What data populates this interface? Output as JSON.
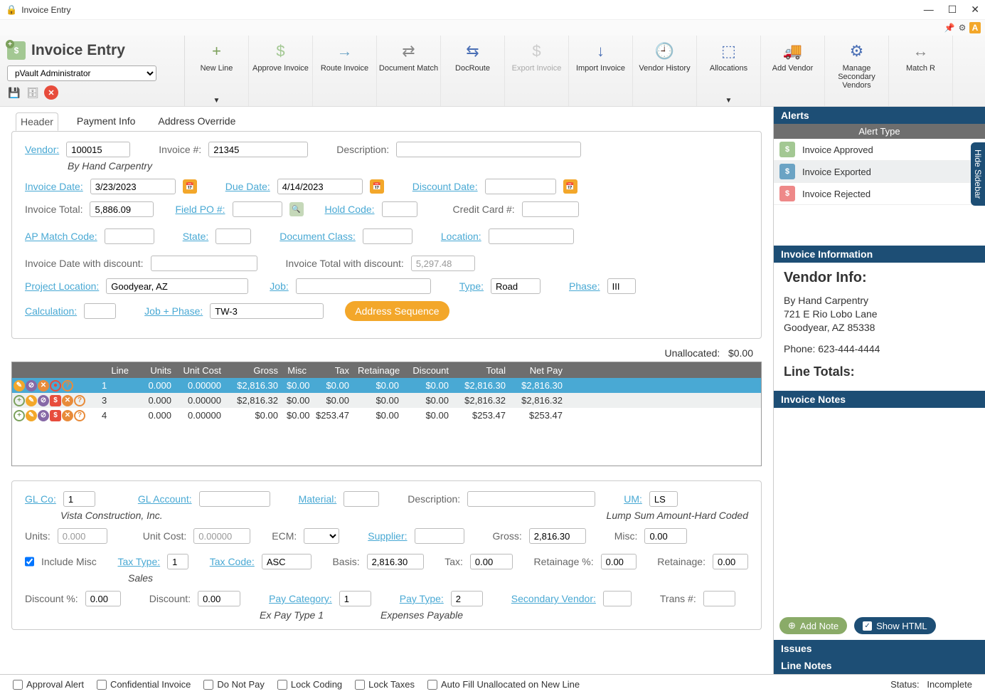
{
  "window": {
    "title": "Invoice Entry"
  },
  "app": {
    "title": "Invoice Entry",
    "user_select": "pVault Administrator"
  },
  "ribbon": [
    {
      "label": "New Line",
      "color": "#7ba05b",
      "glyph": "+",
      "arrow": true
    },
    {
      "label": "Approve Invoice",
      "color": "#a3c893",
      "glyph": "$"
    },
    {
      "label": "Route Invoice",
      "color": "#6ba3c4",
      "glyph": "→"
    },
    {
      "label": "Document Match",
      "color": "#888",
      "glyph": "⇄"
    },
    {
      "label": "DocRoute",
      "color": "#4a6fb5",
      "glyph": "⇆"
    },
    {
      "label": "Export Invoice",
      "color": "#ccc",
      "glyph": "$",
      "disabled": true
    },
    {
      "label": "Import Invoice",
      "color": "#4a6fb5",
      "glyph": "↓"
    },
    {
      "label": "Vendor History",
      "color": "#4a6fb5",
      "glyph": "🕘"
    },
    {
      "label": "Allocations",
      "color": "#4a6fb5",
      "glyph": "⬚",
      "arrow": true
    },
    {
      "label": "Add Vendor",
      "color": "#4a6fb5",
      "glyph": "🚚"
    },
    {
      "label": "Manage Secondary Vendors",
      "color": "#4a6fb5",
      "glyph": "⚙"
    },
    {
      "label": "Match R",
      "color": "#888",
      "glyph": "↔"
    }
  ],
  "tabs": [
    "Header",
    "Payment Info",
    "Address Override"
  ],
  "active_tab": "Header",
  "header": {
    "vendor_label": "Vendor:",
    "vendor": "100015",
    "vendor_name": "By Hand Carpentry",
    "invoice_num_label": "Invoice #:",
    "invoice_num": "21345",
    "description_label": "Description:",
    "description": "",
    "invoice_date_label": "Invoice Date:",
    "invoice_date": "3/23/2023",
    "due_date_label": "Due Date:",
    "due_date": "4/14/2023",
    "discount_date_label": "Discount Date:",
    "discount_date": "",
    "invoice_total_label": "Invoice Total:",
    "invoice_total": "5,886.09",
    "field_po_label": "Field PO #:",
    "field_po": "",
    "hold_code_label": "Hold Code:",
    "hold_code": "",
    "credit_card_label": "Credit Card #:",
    "credit_card": "",
    "ap_match_label": "AP Match Code:",
    "ap_match": "",
    "state_label": "State:",
    "state": "",
    "doc_class_label": "Document Class:",
    "doc_class": "",
    "location_label": "Location:",
    "location": "",
    "inv_date_disc_label": "Invoice Date with discount:",
    "inv_date_disc": "",
    "inv_total_disc_label": "Invoice Total with discount:",
    "inv_total_disc": "5,297.48",
    "proj_loc_label": "Project Location:",
    "proj_loc": "Goodyear, AZ",
    "job_label": "Job:",
    "job": "",
    "type_label": "Type:",
    "type": "Road",
    "phase_label": "Phase:",
    "phase": "III",
    "calc_label": "Calculation:",
    "calc": "",
    "job_phase_label": "Job + Phase:",
    "job_phase": "TW-3",
    "addr_seq_btn": "Address Sequence"
  },
  "unallocated": {
    "label": "Unallocated:",
    "value": "$0.00"
  },
  "grid": {
    "cols": [
      "Line",
      "Units",
      "Unit Cost",
      "Gross",
      "Misc",
      "Tax",
      "Retainage",
      "Discount",
      "Total",
      "Net Pay"
    ],
    "rows": [
      {
        "line": "1",
        "units": "0.000",
        "unitcost": "0.00000",
        "gross": "$2,816.30",
        "misc": "$0.00",
        "tax": "$0.00",
        "ret": "$0.00",
        "disc": "$0.00",
        "total": "$2,816.30",
        "net": "$2,816.30",
        "sel": true
      },
      {
        "line": "3",
        "units": "0.000",
        "unitcost": "0.00000",
        "gross": "$2,816.32",
        "misc": "$0.00",
        "tax": "$0.00",
        "ret": "$0.00",
        "disc": "$0.00",
        "total": "$2,816.32",
        "net": "$2,816.32"
      },
      {
        "line": "4",
        "units": "0.000",
        "unitcost": "0.00000",
        "gross": "$0.00",
        "misc": "$0.00",
        "tax": "$253.47",
        "ret": "$0.00",
        "disc": "$0.00",
        "total": "$253.47",
        "net": "$253.47"
      }
    ]
  },
  "detail": {
    "glco_label": "GL Co:",
    "glco": "1",
    "glco_name": "Vista Construction, Inc.",
    "glacct_label": "GL Account:",
    "glacct": "",
    "material_label": "Material:",
    "material": "",
    "desc_label": "Description:",
    "desc": "",
    "um_label": "UM:",
    "um": "LS",
    "um_name": "Lump Sum Amount-Hard Coded",
    "units_label": "Units:",
    "units": "0.000",
    "unitcost_label": "Unit Cost:",
    "unitcost": "0.00000",
    "ecm_label": "ECM:",
    "ecm": "",
    "supplier_label": "Supplier:",
    "supplier": "",
    "gross_label": "Gross:",
    "gross": "2,816.30",
    "misc_label": "Misc:",
    "misc": "0.00",
    "include_misc_label": "Include Misc",
    "taxtype_label": "Tax Type:",
    "taxtype": "1",
    "taxtype_name": "Sales",
    "taxcode_label": "Tax Code:",
    "taxcode": "ASC",
    "basis_label": "Basis:",
    "basis": "2,816.30",
    "tax_label": "Tax:",
    "tax": "0.00",
    "retpct_label": "Retainage %:",
    "retpct": "0.00",
    "ret_label": "Retainage:",
    "ret": "0.00",
    "discpct_label": "Discount %:",
    "discpct": "0.00",
    "disc_label": "Discount:",
    "disc": "0.00",
    "paycat_label": "Pay Category:",
    "paycat": "1",
    "paycat_name": "Ex Pay Type 1",
    "paytype_label": "Pay Type:",
    "paytype": "2",
    "paytype_name": "Expenses Payable",
    "secvendor_label": "Secondary Vendor:",
    "secvendor": "",
    "trans_label": "Trans #:",
    "trans": ""
  },
  "sidebar": {
    "alerts_title": "Alerts",
    "alert_type_label": "Alert Type",
    "alerts": [
      {
        "label": "Invoice Approved",
        "cls": "ai-g"
      },
      {
        "label": "Invoice Exported",
        "cls": "ai-b",
        "alt": true
      },
      {
        "label": "Invoice Rejected",
        "cls": "ai-r"
      }
    ],
    "info_title": "Invoice Information",
    "vendor_info_title": "Vendor Info:",
    "vendor_name": "By Hand Carpentry",
    "vendor_addr1": "721 E Rio Lobo Lane",
    "vendor_addr2": "Goodyear, AZ 85338",
    "vendor_phone": "Phone: 623-444-4444",
    "line_totals_title": "Line Totals:",
    "notes_title": "Invoice Notes",
    "add_note_btn": "Add Note",
    "show_html_btn": "Show HTML",
    "issues_title": "Issues",
    "line_notes_title": "Line Notes",
    "hide_sidebar": "Hide Sidebar"
  },
  "footer": {
    "opts": [
      "Approval Alert",
      "Confidential Invoice",
      "Do Not Pay",
      "Lock Coding",
      "Lock Taxes",
      "Auto Fill Unallocated on New Line"
    ],
    "status_label": "Status:",
    "status": "Incomplete"
  }
}
